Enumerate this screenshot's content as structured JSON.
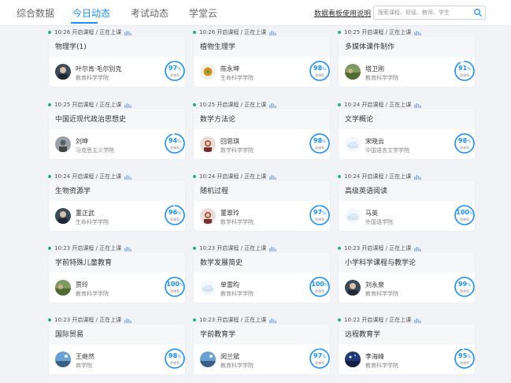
{
  "nav": {
    "tabs": [
      {
        "label": "综合数据"
      },
      {
        "label": "今日动态"
      },
      {
        "label": "考试动态"
      },
      {
        "label": "学堂云"
      }
    ],
    "help_link": "数据看板使用说明",
    "search_placeholder": "搜索课程、班级、教师、学生"
  },
  "cards": [
    {
      "status": "10:26 开启课程 / 正在上课",
      "course": "物理学(1)",
      "teacher": "叶尔肯·毛尔别克",
      "college": "教育科学学院",
      "rate": 97,
      "rate_label": "到课率",
      "avatar": "photo-dark"
    },
    {
      "status": "10:26 开启课程 / 正在上课",
      "course": "植物生理学",
      "teacher": "陈永坤",
      "college": "生命科学学院",
      "rate": 98,
      "rate_label": "到课率",
      "avatar": "photo-orange"
    },
    {
      "status": "10:25 开启课程 / 正在上课",
      "course": "多媒体课件制作",
      "teacher": "塔卫刚",
      "college": "教育科学学院",
      "rate": 91,
      "rate_label": "到课率",
      "avatar": "photo-field"
    },
    {
      "status": "10:25 开启课程 / 正在上课",
      "course": "中国近现代政治思想史",
      "teacher": "刘坤",
      "college": "马克思主义学院",
      "rate": 94,
      "rate_label": "到课率",
      "avatar": "photo-gray"
    },
    {
      "status": "10:25 开启课程 / 正在上课",
      "course": "数学方法论",
      "teacher": "回思琪",
      "college": "数学科学学院",
      "rate": 98,
      "rate_label": "到课率",
      "avatar": "photo-portrait"
    },
    {
      "status": "10:24 开启课程 / 正在上课",
      "course": "文学概论",
      "teacher": "宋晓云",
      "college": "中国语言文学学院",
      "rate": 98,
      "rate_label": "到课率",
      "avatar": "default-cloud"
    },
    {
      "status": "10:24 开启课程 / 正在上课",
      "course": "生物资源学",
      "teacher": "董正武",
      "college": "生命科学学院",
      "rate": 96,
      "rate_label": "到课率",
      "avatar": "photo-dark"
    },
    {
      "status": "10:24 开启课程 / 正在上课",
      "course": "随机过程",
      "teacher": "董翠玲",
      "college": "数学科学学院",
      "rate": 97,
      "rate_label": "到课率",
      "avatar": "photo-portrait"
    },
    {
      "status": "10:24 开启课程 / 正在上课",
      "course": "高级英语阅读",
      "teacher": "马英",
      "college": "外国语学院",
      "rate": 100,
      "rate_label": "到课率",
      "avatar": "default-cloud"
    },
    {
      "status": "10:23 开启课程 / 正在上课",
      "course": "学前特殊儿童教育",
      "teacher": "贾玲",
      "college": "教育科学学院",
      "rate": 100,
      "rate_label": "到课率",
      "avatar": "photo-field"
    },
    {
      "status": "10:23 开启课程 / 正在上课",
      "course": "数学发展简史",
      "teacher": "单雷昀",
      "college": "教育科学学院",
      "rate": 100,
      "rate_label": "到课率",
      "avatar": "default-cloud"
    },
    {
      "status": "10:23 开启课程 / 正在上课",
      "course": "小学科学课程与教学论",
      "teacher": "刘永泉",
      "college": "教育科学学院",
      "rate": 99,
      "rate_label": "到课率",
      "avatar": "photo-dark"
    },
    {
      "status": "10:23 开启课程 / 正在上课",
      "course": "国际贸易",
      "teacher": "王继然",
      "college": "商学院",
      "rate": 98,
      "rate_label": "到课率",
      "avatar": "photo-sky"
    },
    {
      "status": "10:23 开启课程 / 正在上课",
      "course": "学前教育学",
      "teacher": "闵兰斌",
      "college": "教育科学学院",
      "rate": 97,
      "rate_label": "到课率",
      "avatar": "photo-sky"
    },
    {
      "status": "10:22 开启课程 / 正在上课",
      "course": "远程教育学",
      "teacher": "李海峰",
      "college": "教育科学学院",
      "rate": 95,
      "rate_label": "到课率",
      "avatar": "photo-night"
    }
  ],
  "colors": {
    "accent": "#1890ff",
    "live_dot": "#22b573"
  }
}
